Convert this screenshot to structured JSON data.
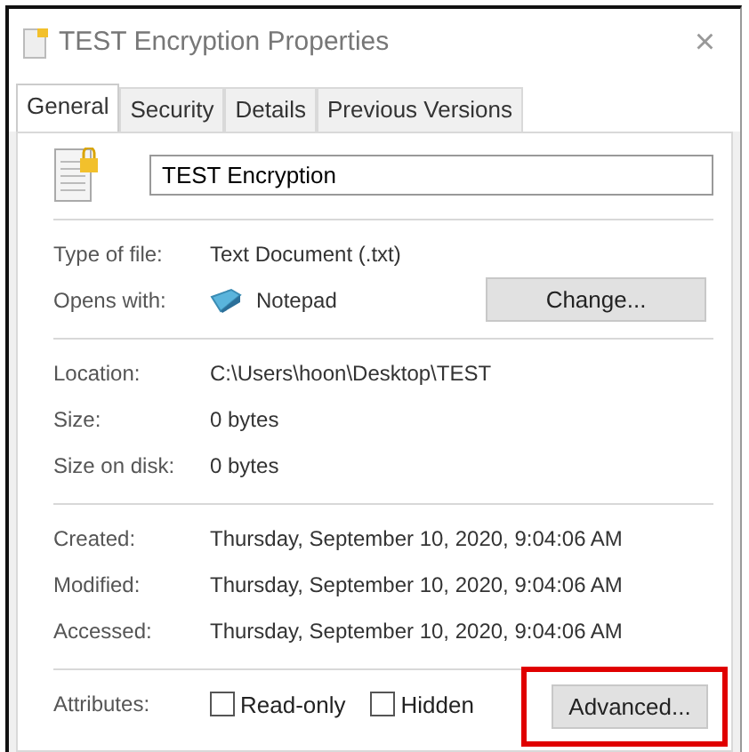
{
  "window": {
    "title": "TEST Encryption Properties",
    "close": "×"
  },
  "tabs": [
    {
      "label": "General",
      "selected": true
    },
    {
      "label": "Security",
      "selected": false
    },
    {
      "label": "Details",
      "selected": false
    },
    {
      "label": "Previous Versions",
      "selected": false
    }
  ],
  "name_field": {
    "value": "TEST Encryption"
  },
  "sections": [
    [
      {
        "label": "Type of file:",
        "value": "Text Document (.txt)"
      },
      {
        "label": "Opens with:",
        "value": "Notepad",
        "app_icon": true,
        "button": "Change..."
      }
    ],
    [
      {
        "label": "Location:",
        "value": "C:\\Users\\hoon\\Desktop\\TEST"
      },
      {
        "label": "Size:",
        "value": "0 bytes"
      },
      {
        "label": "Size on disk:",
        "value": "0 bytes"
      }
    ],
    [
      {
        "label": "Created:",
        "value": "Thursday, September 10, 2020, 9:04:06 AM"
      },
      {
        "label": "Modified:",
        "value": "Thursday, September 10, 2020, 9:04:06 AM"
      },
      {
        "label": "Accessed:",
        "value": "Thursday, September 10, 2020, 9:04:06 AM"
      }
    ]
  ],
  "attributes": {
    "label": "Attributes:",
    "checkboxes": [
      {
        "label": "Read-only",
        "checked": false
      },
      {
        "label": "Hidden",
        "checked": false
      }
    ],
    "button": "Advanced...",
    "highlighted": true
  }
}
